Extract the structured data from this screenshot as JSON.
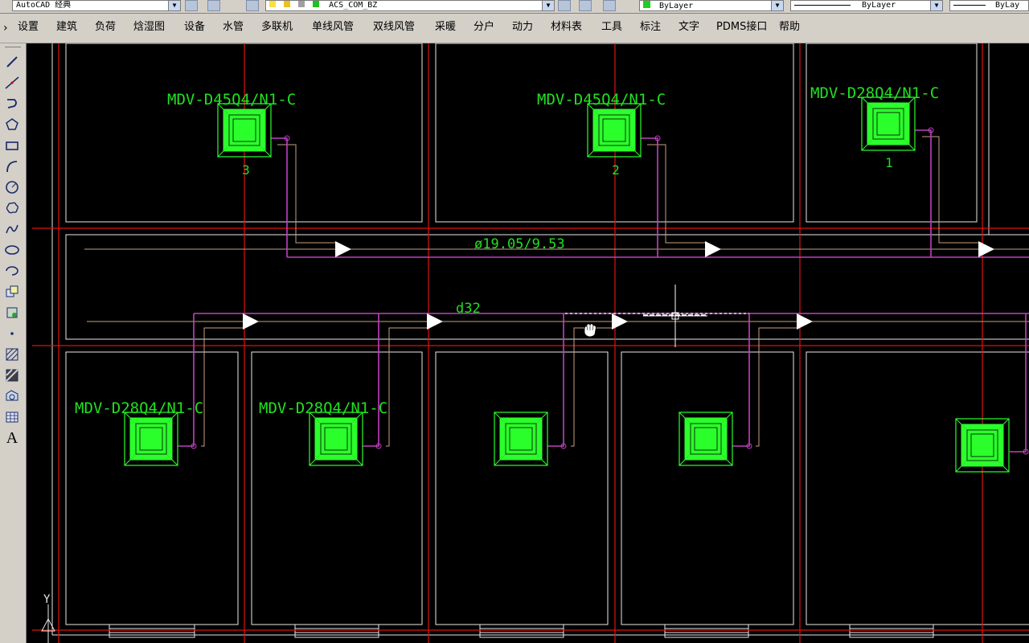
{
  "toolbar_top": {
    "workspace": "AutoCAD 经典",
    "layer": "ACS_COM_BZ",
    "color": "ByLayer",
    "linetype": "ByLayer",
    "lineweight": "ByLay"
  },
  "menu": [
    {
      "label": "设置"
    },
    {
      "label": "建筑"
    },
    {
      "label": "负荷"
    },
    {
      "label": "焓湿图"
    },
    {
      "label": "设备"
    },
    {
      "label": "水管"
    },
    {
      "label": "多联机"
    },
    {
      "label": "单线风管"
    },
    {
      "label": "双线风管"
    },
    {
      "label": "采暖"
    },
    {
      "label": "分户"
    },
    {
      "label": "动力"
    },
    {
      "label": "材料表"
    },
    {
      "label": "工具"
    },
    {
      "label": "标注"
    },
    {
      "label": "文字"
    },
    {
      "label": "PDMS接口"
    },
    {
      "label": "帮助"
    }
  ],
  "left_tools": [
    {
      "icon": "line-icon"
    },
    {
      "icon": "construction-line-icon"
    },
    {
      "icon": "polyline-icon"
    },
    {
      "icon": "polygon-icon"
    },
    {
      "icon": "rectangle-icon"
    },
    {
      "icon": "arc-icon"
    },
    {
      "icon": "circle-icon"
    },
    {
      "icon": "revision-cloud-icon"
    },
    {
      "icon": "spline-icon"
    },
    {
      "icon": "ellipse-icon"
    },
    {
      "icon": "ellipse-arc-icon"
    },
    {
      "icon": "insert-block-icon"
    },
    {
      "icon": "make-block-icon"
    },
    {
      "icon": "point-icon"
    },
    {
      "icon": "hatch-icon"
    },
    {
      "icon": "gradient-icon"
    },
    {
      "icon": "region-icon"
    },
    {
      "icon": "table-icon"
    },
    {
      "icon": "multiline-text-icon",
      "text": "A"
    }
  ],
  "drawing": {
    "units": [
      {
        "model": "MDV-D45Q4/N1-C",
        "number": "3"
      },
      {
        "model": "MDV-D45Q4/N1-C",
        "number": "2"
      },
      {
        "model": "MDV-D28Q4/N1-C",
        "number": "1"
      },
      {
        "model": "MDV-D28Q4/N1-C",
        "number": ""
      },
      {
        "model": "MDV-D28Q4/N1-C",
        "number": ""
      },
      {
        "model": "",
        "number": ""
      },
      {
        "model": "",
        "number": ""
      },
      {
        "model": "",
        "number": ""
      }
    ],
    "pipe_label": "ø19.05/9.53",
    "drain_label": "d32",
    "ucs_y": "Y",
    "colors": {
      "unit_green": "#2bff2b",
      "grid_red": "#e01010",
      "refrigerant_magenta": "#c040c0",
      "drain_tan": "#c8a080",
      "wall_white": "#e8e8e8",
      "text_green": "#20e020"
    }
  }
}
